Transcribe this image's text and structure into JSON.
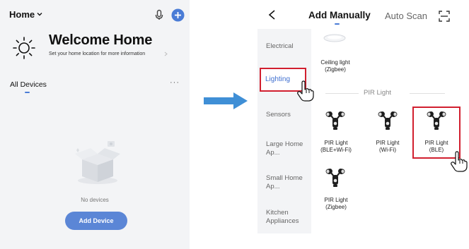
{
  "left_screen": {
    "home_title": "Home",
    "welcome_title": "Welcome Home",
    "location_hint": "Set your home location for more information",
    "all_devices_label": "All Devices",
    "more_label": "···",
    "empty_text": "No devices",
    "add_device_button": "Add Device"
  },
  "right_screen": {
    "tabs": [
      {
        "label": "Add Manually",
        "active": true
      },
      {
        "label": "Auto Scan",
        "active": false
      }
    ],
    "categories": [
      {
        "label": "Electrical"
      },
      {
        "label": "Lighting",
        "selected": true
      },
      {
        "label": "Sensors"
      },
      {
        "label": "Large Home Ap..."
      },
      {
        "label": "Small Home Ap..."
      },
      {
        "label": "Kitchen Appliances"
      }
    ],
    "top_product": {
      "line1": "Ceiling light",
      "line2": "(Zigbee)"
    },
    "section_title": "PIR Light",
    "products": [
      {
        "line1": "PIR Light",
        "line2": "(BLE+Wi-Fi)"
      },
      {
        "line1": "PIR Light",
        "line2": "(Wi-Fi)"
      },
      {
        "line1": "PIR Light",
        "line2": "(BLE)",
        "highlighted": true
      },
      {
        "line1": "PIR Light",
        "line2": "(Zigbee)"
      }
    ]
  },
  "colors": {
    "accent": "#4a7cd6",
    "button": "#5b86d6",
    "highlight": "#d11f2f",
    "arrow": "#3f8fd6"
  },
  "icons": [
    "chevron-down-icon",
    "microphone-icon",
    "plus-icon",
    "sun-icon",
    "chevron-right-icon",
    "empty-box-icon",
    "back-icon",
    "scan-icon",
    "pointing-hand-icon",
    "arrow-right-icon"
  ]
}
